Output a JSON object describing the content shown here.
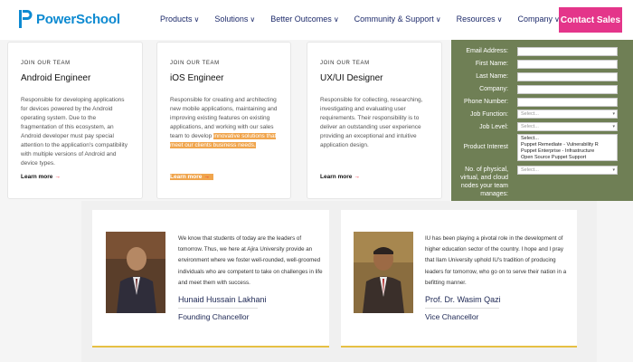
{
  "brand": {
    "name": "PowerSchool",
    "accent": "#0d8ad1",
    "cta_color": "#e4358a"
  },
  "nav": [
    {
      "label": "Products"
    },
    {
      "label": "Solutions"
    },
    {
      "label": "Better Outcomes"
    },
    {
      "label": "Community & Support"
    },
    {
      "label": "Resources"
    },
    {
      "label": "Company"
    }
  ],
  "cta": {
    "label": "Contact Sales"
  },
  "jobs": [
    {
      "kicker": "JOIN OUR TEAM",
      "title": "Android Engineer",
      "desc": "Responsible for developing applications for devices powered by the Android operating system. Due to the fragmentation of this ecosystem, an Android developer must pay special attention to the application's compatibility with multiple versions of Android and device types.",
      "link": "Learn more"
    },
    {
      "kicker": "JOIN OUR TEAM",
      "title": "iOS Engineer",
      "desc_a": "Responsible for creating and architecting new mobile applications, maintaining and improving existing features on existing applications, and working with our sales team to develop",
      "desc_hl": "innovative solutions that meet our clients business needs.",
      "link": "Learn more"
    },
    {
      "kicker": "JOIN OUR TEAM",
      "title": "UX/UI Designer",
      "desc": "Responsible for collecting, researching, investigating and evaluating user requirements. Their responsibility is to deliver an outstanding user experience providing an exceptional and intuitive application design.",
      "link": "Learn more"
    }
  ],
  "form": {
    "email": "Email Address:",
    "first": "First Name:",
    "last": "Last Name:",
    "company": "Company:",
    "phone": "Phone Number:",
    "job_function": "Job Function:",
    "job_level": "Job Level:",
    "interest": "Product Interest",
    "nodes": "No. of physical, virtual, and cloud nodes your team manages:",
    "select_placeholder": "Select...",
    "interest_options": [
      "Select...",
      "Puppet Remediate - Vulnerability R",
      "Puppet Enterprise - Infrastructure",
      "Open Source Puppet Support"
    ]
  },
  "testimonials": [
    {
      "quote": "We know that students of today are the leaders of tomorrow. Thus, we here at Ajira University provide an environment where we foster well-rounded, well-groomed individuals who are competent to take on challenges in life and meet them with success.",
      "name": "Hunaid Hussain Lakhani",
      "role": "Founding Chancellor"
    },
    {
      "quote": "IU has been playing a pivotal role in the development of higher education sector of the country. I hope and I pray that Ilam University uphold IU's tradition of producing leaders for tomorrow, who go on to serve their nation in a befitting manner.",
      "name": "Prof. Dr. Wasim Qazi",
      "role": "Vice Chancellor"
    }
  ]
}
